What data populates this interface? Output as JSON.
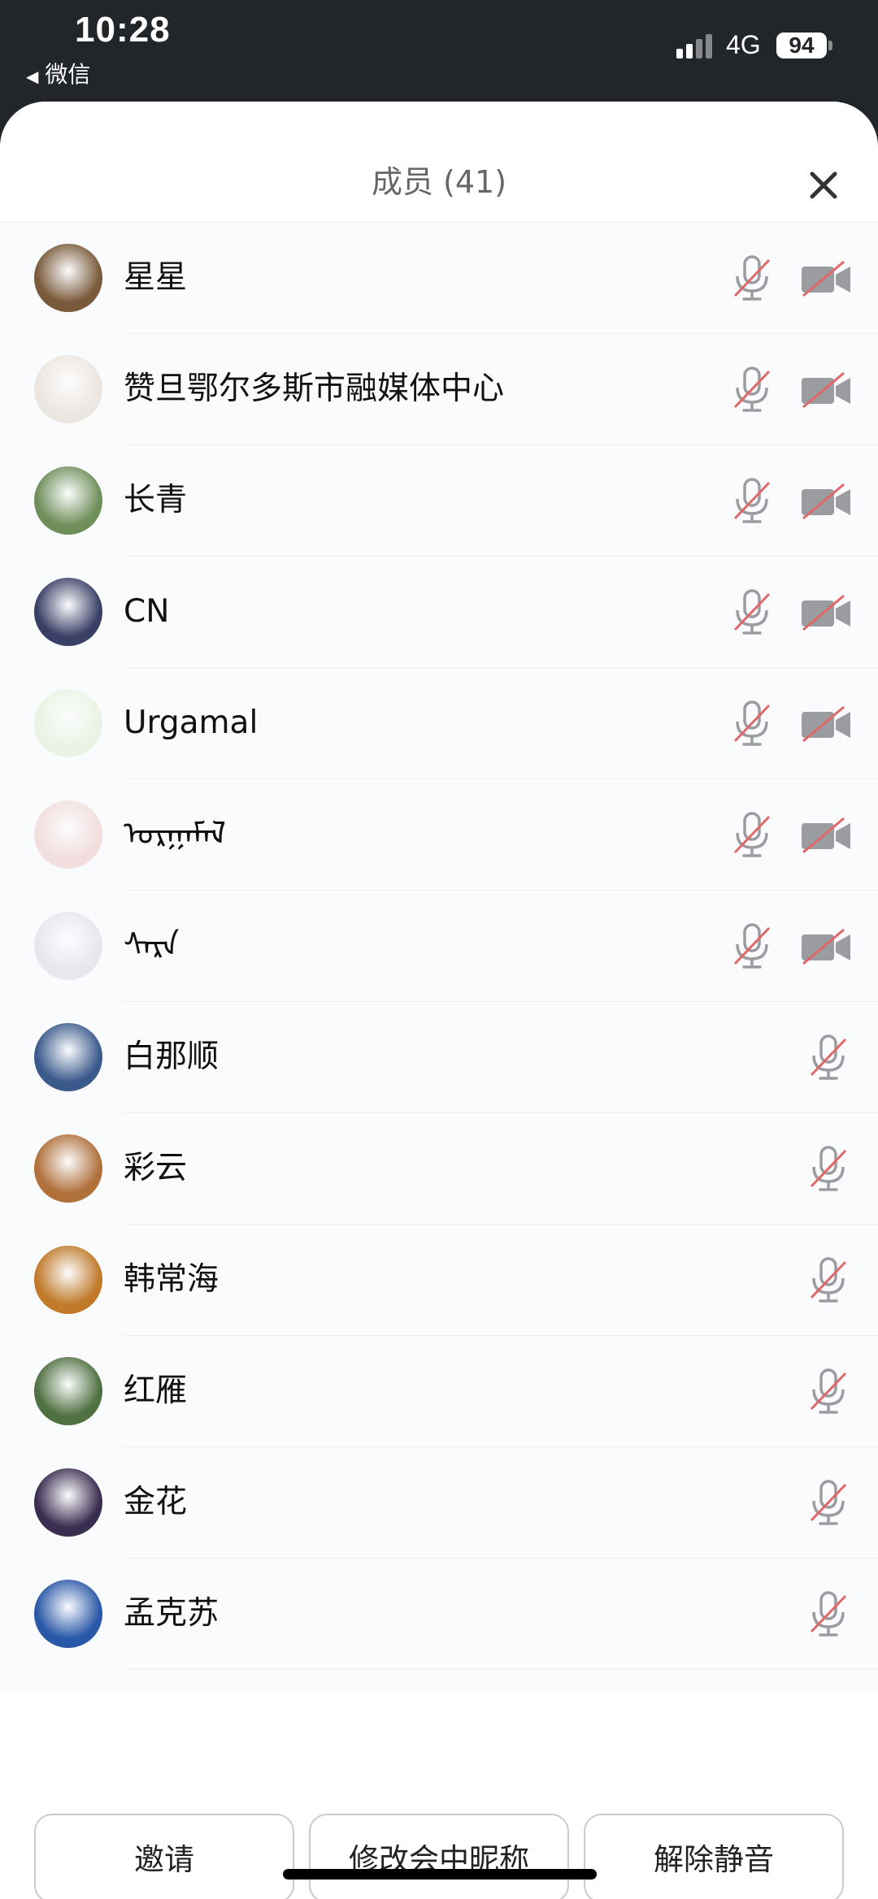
{
  "status_bar": {
    "time": "10:28",
    "back_label": "微信",
    "network": "4G",
    "battery": "94"
  },
  "header": {
    "title": "成员 (41)"
  },
  "members": [
    {
      "name": "星星",
      "video": true,
      "avatar_color": "#7a5a3a"
    },
    {
      "name": "赞旦鄂尔多斯市融媒体中心",
      "video": true,
      "avatar_color": "#ece6e0"
    },
    {
      "name": "长青",
      "video": true,
      "avatar_color": "#6f8f5a"
    },
    {
      "name": "CN",
      "video": true,
      "avatar_color": "#3a3f66"
    },
    {
      "name": "Urgamal",
      "video": true,
      "avatar_color": "#e9f3e3"
    },
    {
      "name": "ᠤᠷᠭᠠᠮᠠᠯ",
      "video": true,
      "avatar_color": "#f2dede"
    },
    {
      "name": "ᠰᠠᠷᠠ",
      "video": true,
      "avatar_color": "#e6e8ee"
    },
    {
      "name": "白那顺",
      "video": false,
      "avatar_color": "#3b5a8c"
    },
    {
      "name": "彩云",
      "video": false,
      "avatar_color": "#b0703a"
    },
    {
      "name": "韩常海",
      "video": false,
      "avatar_color": "#c07a2a"
    },
    {
      "name": "红雁",
      "video": false,
      "avatar_color": "#4f7040"
    },
    {
      "name": "金花",
      "video": false,
      "avatar_color": "#3a2e50"
    },
    {
      "name": "孟克苏",
      "video": false,
      "avatar_color": "#2a58a8"
    }
  ],
  "footer": {
    "invite": "邀请",
    "rename": "修改会中昵称",
    "unmute": "解除静音"
  },
  "colors": {
    "muted_slash": "#e06868",
    "icon_gray": "#9a9ca0"
  }
}
